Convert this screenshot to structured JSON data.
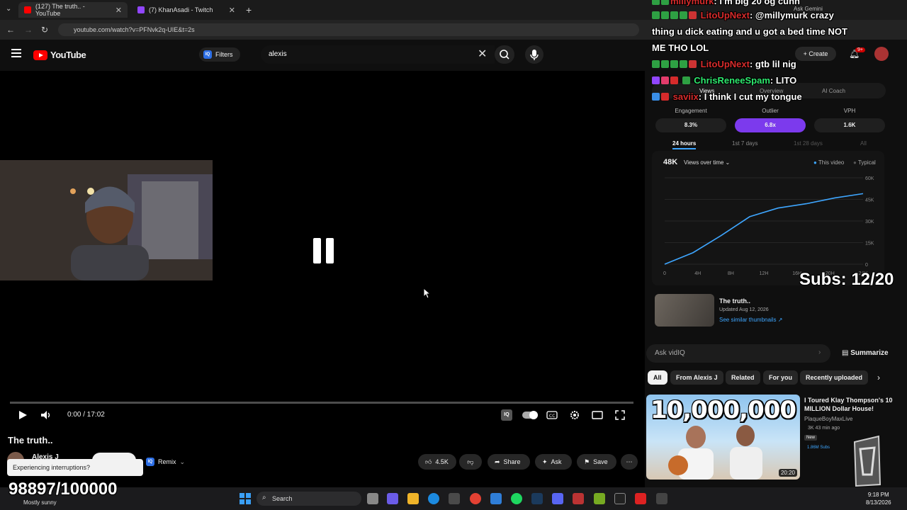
{
  "browser": {
    "tabs": [
      {
        "title": "(127) The truth.. - YouTube",
        "color": "#ff0000"
      },
      {
        "title": "(7) KhanAsadi - Twitch",
        "color": "#9146ff"
      }
    ],
    "new_tab": "+",
    "url": "youtube.com/watch?v=PFNvk2q-UIE&t=2s"
  },
  "youtube": {
    "logo": "YouTube",
    "filters_label": "Filters",
    "iq_label": "IQ",
    "search_value": "alexis"
  },
  "player": {
    "time": "0:00 / 17:02",
    "progress": 0
  },
  "video": {
    "title": "The truth..",
    "channel": "Alexis J",
    "remix_label": "Remix",
    "likes": "4.5K",
    "share_label": "Share",
    "ask_label": "Ask",
    "save_label": "Save"
  },
  "overlay": {
    "toast": "Experiencing interruptions?",
    "sub_goal": "98897/100000",
    "weather": "Mostly sunny",
    "subs": "Subs: 12/20"
  },
  "chat": [
    {
      "user": "millymurk",
      "text": ": I'm big 20 og cuhh",
      "color": "#d62b2b"
    },
    {
      "user": "LitoUpNext",
      "text": ": @millymurk crazy",
      "color": "#d62b2b"
    },
    {
      "user": "",
      "text": "thing u dick eating and u got a bed time NOT",
      "color": "#fff"
    },
    {
      "user": "",
      "text": "ME THO LOL",
      "color": "#fff"
    },
    {
      "user": "LitoUpNext",
      "text": ": gtb lil nig",
      "color": "#d62b2b"
    },
    {
      "user": "ChrisReneeSpam",
      "text": ": LITO",
      "color": "#2ee86e"
    },
    {
      "user": "saviix",
      "text": ": I think I cut my tongue",
      "color": "#d62b2b"
    }
  ],
  "vidiq": {
    "tabs": [
      "Views",
      "Overview",
      "AI Coach"
    ],
    "stats": [
      {
        "label": "Engagement",
        "value": "8.3%"
      },
      {
        "label": "Outlier",
        "value": "6.8x"
      },
      {
        "label": "VPH",
        "value": "1.6K"
      }
    ],
    "ranges": [
      "24 hours",
      "1st 7 days",
      "1st 28 days",
      "All"
    ],
    "views": "48K",
    "views_dropdown": "Views over time",
    "legend_this": "This video",
    "legend_typical": "Typical",
    "thumb_title": "The truth..",
    "thumb_date": "Updated Aug 12, 2026",
    "thumb_link": "See similar thumbnails ↗",
    "ask_placeholder": "Ask vidIQ",
    "summarize": "Summarize"
  },
  "chart_data": {
    "type": "line",
    "x": [
      "0",
      "4H",
      "8H",
      "12H",
      "16H",
      "20H",
      "24H"
    ],
    "series": [
      {
        "name": "This video",
        "values": [
          0,
          8,
          20,
          33,
          39,
          42,
          46,
          49
        ]
      }
    ],
    "ylim": [
      0,
      60
    ],
    "yticks": [
      "0",
      "15K",
      "30K",
      "45K",
      "60K"
    ],
    "grid": true,
    "legend": "top-right"
  },
  "related": {
    "chips": [
      "All",
      "From Alexis J",
      "Related",
      "For you",
      "Recently uploaded"
    ],
    "video": {
      "thumb_text": "10,000,000",
      "title": "I Toured Klay Thompson's 10 MILLION Dollar House!",
      "channel": "PlaqueBoyMaxLive",
      "meta": "3K  43 min ago",
      "badge": "New",
      "subs": "1.86M Subs",
      "duration": "20:20"
    }
  },
  "taskbar": {
    "search": "Search",
    "time": "9:18 PM",
    "date": "8/13/2026"
  },
  "header_right": {
    "create": "Create",
    "notif_count": "9+",
    "ask_gemini": "Ask Gemini"
  }
}
